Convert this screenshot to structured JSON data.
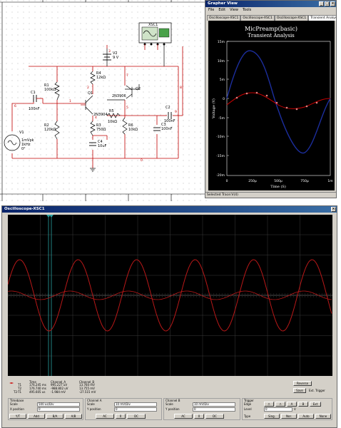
{
  "schematic": {
    "xsc": "XSC1",
    "v2": {
      "name": "V2",
      "value": "9 V"
    },
    "r4": {
      "name": "R4",
      "value": "12kΩ"
    },
    "r1": {
      "name": "R1",
      "value": "100kΩ"
    },
    "r2": {
      "name": "R2",
      "value": "120kΩ"
    },
    "r3": {
      "name": "R3",
      "value": "750Ω"
    },
    "r5": {
      "name": "R5",
      "value": "10kΩ"
    },
    "r6": {
      "name": "R6",
      "value": "10kΩ"
    },
    "c1": {
      "name": "C1",
      "value": "100nF"
    },
    "c2": {
      "name": "C2",
      "value": "100nF"
    },
    "c3": {
      "name": "C3",
      "value": "100nF"
    },
    "c4": {
      "name": "C4",
      "value": "10uF"
    },
    "q1": {
      "name": "Q1",
      "model": "2N3904"
    },
    "q2": {
      "name": "Q2",
      "model": "2N3906"
    },
    "v1": {
      "name": "V1",
      "line1": "1mVpk",
      "line2": "1kHz",
      "line3": "0°"
    },
    "nodes": {
      "n0": "0",
      "n1": "1",
      "n2": "2",
      "n3": "3",
      "n4": "4",
      "n5": "5",
      "n6": "6",
      "n7": "7",
      "n8": "8",
      "n9": "9"
    }
  },
  "grapher": {
    "title": "Grapher View",
    "menu": [
      "File",
      "Edit",
      "View",
      "Tools"
    ],
    "tabs": [
      "Oscilloscope-XSC1",
      "Oscilloscope-XSC1",
      "Oscilloscope-XSC1",
      "Transient Analysis"
    ],
    "plot_title": "MicPreamp(basic)",
    "plot_subtitle": "Transient Analysis",
    "ylabel": "Voltage (V)",
    "xlabel": "Time (S)",
    "status": "Selected Trace:V(4)"
  },
  "oscilloscope": {
    "title": "Oscilloscope-XSC1",
    "readout": {
      "headers": [
        "Time",
        "Channel_A",
        "Channel_B"
      ],
      "t1": {
        "label": "T1",
        "time": "176.245 ms",
        "a": "995.227 uV",
        "b": "13.760 mV"
      },
      "t2": {
        "label": "T2",
        "time": "176.740 ms",
        "a": "-988.802 uV",
        "b": "13.755 mV"
      },
      "t21": {
        "label": "T2-T1",
        "time": "495.605 us",
        "a": "-1.984 mV",
        "b": "-27.515 mV"
      }
    },
    "buttons": {
      "reverse": "Reverse",
      "save": "Save",
      "ext_trigger": "Ext. Trigger"
    },
    "timebase": {
      "title": "Timebase",
      "scale_label": "Scale",
      "scale": "500 us/Div",
      "xpos_label": "X position",
      "xpos": "0",
      "modes": [
        "Y/T",
        "Add",
        "B/A",
        "A/B"
      ]
    },
    "channel_a": {
      "title": "Channel A",
      "scale_label": "Scale",
      "scale": "10 mV/Div",
      "ypos_label": "Y position",
      "ypos": "0",
      "coupling": [
        "AC",
        "0",
        "DC"
      ]
    },
    "channel_b": {
      "title": "Channel B",
      "scale_label": "Scale",
      "scale": "10 mV/Div",
      "ypos_label": "Y position",
      "ypos": "0",
      "coupling": [
        "AC",
        "0",
        "DC"
      ]
    },
    "trigger": {
      "title": "Trigger",
      "edge_label": "Edge",
      "edge_a": "A",
      "edge_b": "B",
      "ext": "Ext",
      "level_label": "Level",
      "level": "0",
      "level_unit": "V",
      "type_label": "Type",
      "types": [
        "Sing.",
        "Nor.",
        "Auto",
        "None"
      ]
    }
  }
}
